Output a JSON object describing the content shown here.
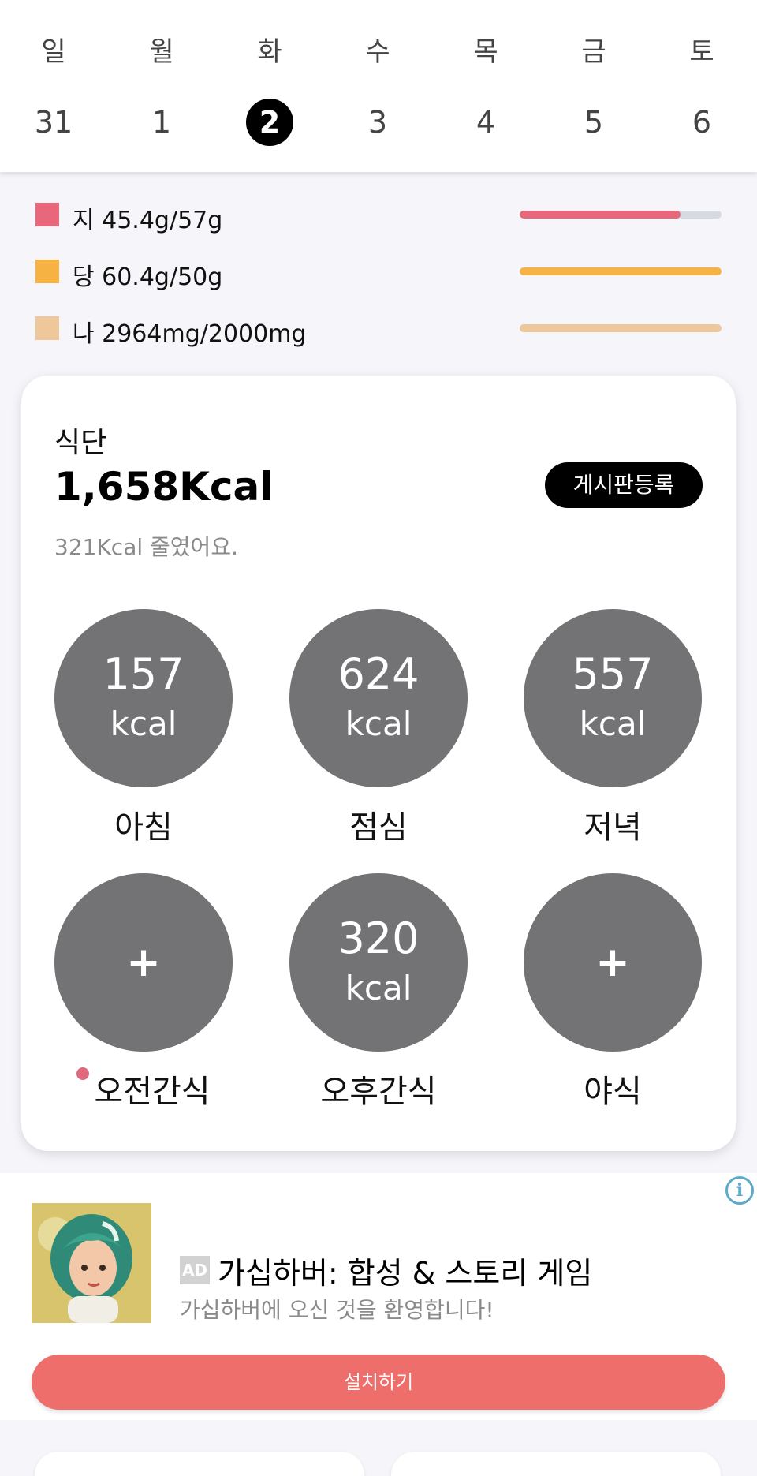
{
  "week": {
    "days": [
      "일",
      "월",
      "화",
      "수",
      "목",
      "금",
      "토"
    ],
    "dates": [
      "31",
      "1",
      "2",
      "3",
      "4",
      "5",
      "6"
    ],
    "selected_index": 2
  },
  "nutrients": [
    {
      "label": "지 45.4g/57g",
      "color": "#e8677b",
      "fraction": 0.797
    },
    {
      "label": "당 60.4g/50g",
      "color": "#f7b244",
      "fraction": 1.0
    },
    {
      "label": "나 2964mg/2000mg",
      "color": "#eec79a",
      "fraction": 1.0
    }
  ],
  "diet": {
    "title": "식단",
    "total_kcal": "1,658Kcal",
    "subtitle": "321Kcal 줄였어요.",
    "board_button": "게시판등록",
    "meals": [
      {
        "num": "157",
        "unit": "kcal",
        "label": "아침",
        "empty": false
      },
      {
        "num": "624",
        "unit": "kcal",
        "label": "점심",
        "empty": false
      },
      {
        "num": "557",
        "unit": "kcal",
        "label": "저녁",
        "empty": false
      },
      {
        "num": "+",
        "unit": "",
        "label": "오전간식",
        "empty": true,
        "dot": true
      },
      {
        "num": "320",
        "unit": "kcal",
        "label": "오후간식",
        "empty": false
      },
      {
        "num": "+",
        "unit": "",
        "label": "야식",
        "empty": true
      }
    ]
  },
  "ad": {
    "badge": "AD",
    "title": "가십하버: 합성 & 스토리 게임",
    "subtitle": "가십하버에 오신 것을 환영합니다!",
    "install": "설치하기",
    "info_icon": "info-icon"
  }
}
